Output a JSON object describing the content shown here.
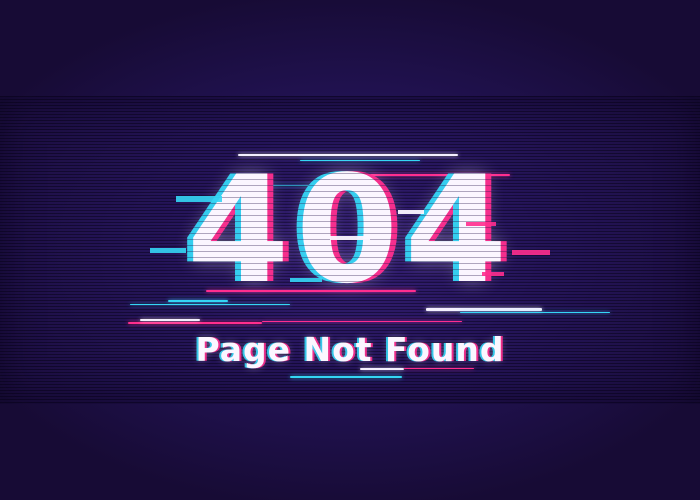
{
  "error": {
    "code": "404",
    "message": "Page Not Found"
  },
  "colors": {
    "background": "#24145a",
    "text": "#fbf6ff",
    "glitch_cyan": "#35d6f5",
    "glitch_pink": "#ff2e8e"
  }
}
